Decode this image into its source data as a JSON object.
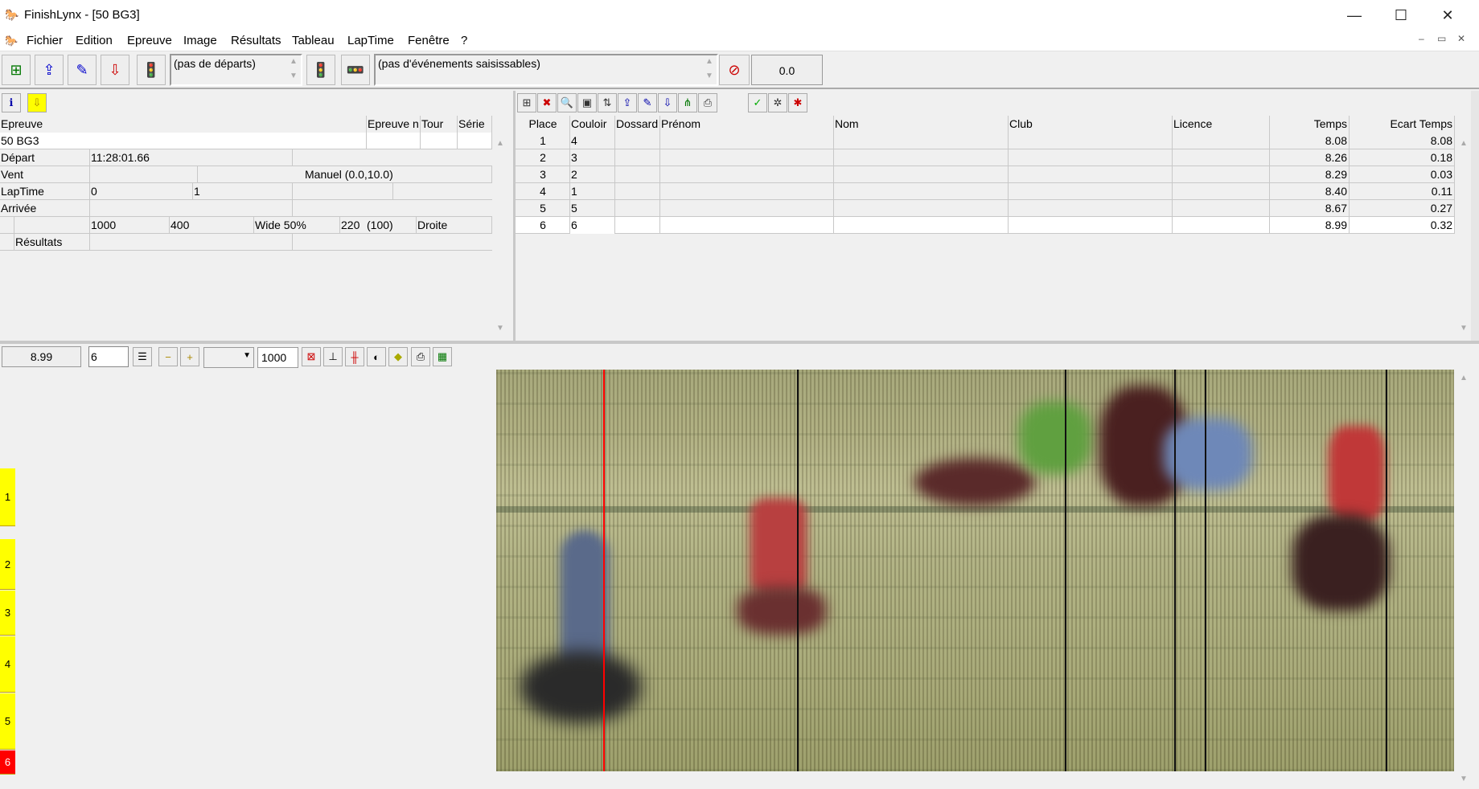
{
  "window": {
    "title": "FinishLynx - [50 BG3]",
    "min": "—",
    "max": "☐",
    "close": "✕"
  },
  "menu": [
    "Fichier",
    "Edition",
    "Epreuve",
    "Image",
    "Résultats",
    "Tableau",
    "LapTime",
    "Fenêtre",
    "?"
  ],
  "mdi": {
    "min": "–",
    "restore": "▭",
    "close": "✕"
  },
  "toolbar": {
    "starts_combo": "(pas de départs)",
    "events_combo": "(pas d'événements saisissables)",
    "value": "0.0"
  },
  "event_panel": {
    "headers": {
      "epreuve": "Epreuve",
      "epreuve_n": "Epreuve n",
      "tour": "Tour",
      "serie": "Série"
    },
    "event_name": "50 BG3",
    "depart_label": "Départ",
    "depart_value": "11:28:01.66",
    "vent_label": "Vent",
    "vent_value": "Manuel (0.0,10.0)",
    "laptime_label": "LapTime",
    "laptime_a": "0",
    "laptime_b": "1",
    "arrivee_label": "Arrivée",
    "cam": {
      "a": "1000",
      "b": "400",
      "c": "Wide 50%",
      "d": "220",
      "e": "(100)",
      "f": "Droite"
    },
    "resultats_label": "Résultats"
  },
  "results": {
    "headers": {
      "place": "Place",
      "couloir": "Couloir",
      "dossard": "Dossard",
      "prenom": "Prénom",
      "nom": "Nom",
      "club": "Club",
      "licence": "Licence",
      "temps": "Temps",
      "ecart": "Ecart Temps"
    },
    "rows": [
      {
        "place": "1",
        "couloir": "4",
        "temps": "8.08",
        "ecart": "8.08"
      },
      {
        "place": "2",
        "couloir": "3",
        "temps": "8.26",
        "ecart": "0.18"
      },
      {
        "place": "3",
        "couloir": "2",
        "temps": "8.29",
        "ecart": "0.03"
      },
      {
        "place": "4",
        "couloir": "1",
        "temps": "8.40",
        "ecart": "0.11"
      },
      {
        "place": "5",
        "couloir": "5",
        "temps": "8.67",
        "ecart": "0.27"
      },
      {
        "place": "6",
        "couloir": "6",
        "temps": "8.99",
        "ecart": "0.32"
      }
    ]
  },
  "image_bar": {
    "time": "8.99",
    "lane_input": "6",
    "density": "1000"
  },
  "lanes": [
    "1",
    "2",
    "3",
    "4",
    "5",
    "6"
  ],
  "colors": {
    "lane": "#ffff00",
    "lane_selected": "#ff0000",
    "cursor": "#ff0000"
  }
}
